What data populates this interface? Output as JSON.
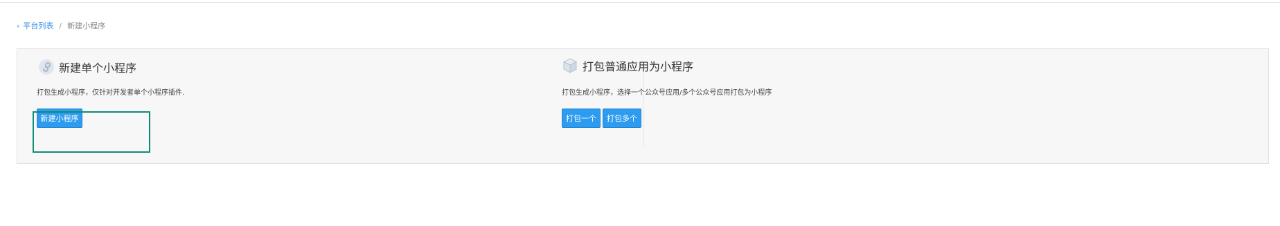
{
  "breadcrumb": {
    "back_label": "平台列表",
    "separator": "/",
    "current": "新建小程序"
  },
  "card_single": {
    "icon": "miniprogram-logo-icon",
    "title": "新建单个小程序",
    "description": "打包生成小程序，仅针对开发者单个小程序插件.",
    "button_label": "新建小程序"
  },
  "card_package": {
    "icon": "package-box-icon",
    "title": "打包普通应用为小程序",
    "description": "打包生成小程序，选择一个公众号应用/多个公众号应用打包为小程序",
    "button_one_label": "打包一个",
    "button_many_label": "打包多个"
  },
  "colors": {
    "primary": "#2d9cf0",
    "highlight": "#0e8c7a",
    "link": "#3a8ee6"
  }
}
